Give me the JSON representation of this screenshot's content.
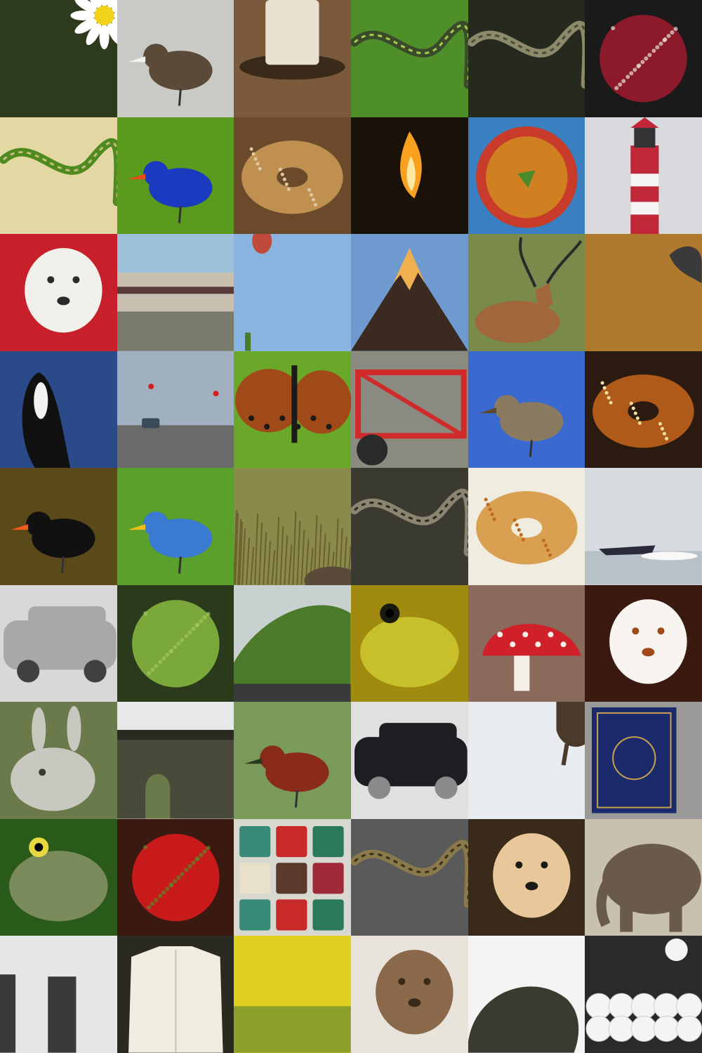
{
  "grid": {
    "columns": 6,
    "rows": 9,
    "tiles": [
      {
        "name": "daisy-flower",
        "subject": "flower",
        "bg": "#2e3a1c",
        "fg": "#ffffff",
        "accent": "#f2d31a"
      },
      {
        "name": "sandpiper-bird",
        "subject": "bird",
        "bg": "#c9c9c6",
        "fg": "#5b4a37",
        "accent": "#f1f1ef"
      },
      {
        "name": "coffee-cup",
        "subject": "cup",
        "bg": "#7a5a3a",
        "fg": "#e8e0d0",
        "accent": "#3a2a1a"
      },
      {
        "name": "green-snake-leaf",
        "subject": "snake",
        "bg": "#4f8f2a",
        "fg": "#3a4a2a",
        "accent": "#9fcf4a"
      },
      {
        "name": "viper-snake",
        "subject": "snake",
        "bg": "#262a1e",
        "fg": "#8c8a6a",
        "accent": "#4a4a3a"
      },
      {
        "name": "pomegranate",
        "subject": "fruit",
        "bg": "#1a1a1a",
        "fg": "#8c1a2a",
        "accent": "#e7e0d6"
      },
      {
        "name": "green-vine-snake",
        "subject": "snake",
        "bg": "#e3d7a4",
        "fg": "#4f8a1e",
        "accent": "#c8bb80"
      },
      {
        "name": "blue-bird",
        "subject": "bird",
        "bg": "#5a9a1c",
        "fg": "#1a3ac0",
        "accent": "#e84a1a"
      },
      {
        "name": "bagel-bread",
        "subject": "bread",
        "bg": "#6a4a2a",
        "fg": "#c09050",
        "accent": "#e0c8a0"
      },
      {
        "name": "flame-torch",
        "subject": "fire",
        "bg": "#1a1208",
        "fg": "#f8a020",
        "accent": "#ffe8a0"
      },
      {
        "name": "soup-bowl",
        "subject": "food",
        "bg": "#3a80c0",
        "fg": "#d08020",
        "accent": "#c83a2a"
      },
      {
        "name": "lighthouse",
        "subject": "tower",
        "bg": "#d8dade",
        "fg": "#c0283a",
        "accent": "#f4f4f4"
      },
      {
        "name": "shih-tzu-dog",
        "subject": "dog",
        "bg": "#c8202a",
        "fg": "#f2f0ea",
        "accent": "#2a2a2a"
      },
      {
        "name": "passenger-train",
        "subject": "train",
        "bg": "#9ec0d8",
        "fg": "#c8c0b0",
        "accent": "#5a3a3a"
      },
      {
        "name": "hot-air-balloon-sky",
        "subject": "sky",
        "bg": "#8ab4e0",
        "fg": "#3a3a6a",
        "accent": "#c04a3a"
      },
      {
        "name": "erupting-volcano",
        "subject": "mountain",
        "bg": "#6e9ad0",
        "fg": "#3a2a20",
        "accent": "#f0b050"
      },
      {
        "name": "impala-antelope",
        "subject": "antelope",
        "bg": "#7a8a4a",
        "fg": "#a0683a",
        "accent": "#2a2a2a"
      },
      {
        "name": "golden-surface",
        "subject": "object",
        "bg": "#b07a2e",
        "fg": "#3a3a3a",
        "accent": "#d0a050"
      },
      {
        "name": "orca-whale",
        "subject": "whale",
        "bg": "#2a4a8a",
        "fg": "#111111",
        "accent": "#f2f2f2"
      },
      {
        "name": "traffic-intersection",
        "subject": "street",
        "bg": "#a0b0c0",
        "fg": "#6a6a6a",
        "accent": "#d02020"
      },
      {
        "name": "brown-butterfly",
        "subject": "butterfly",
        "bg": "#6aa82a",
        "fg": "#a04a1a",
        "accent": "#1a1a1a"
      },
      {
        "name": "red-machinery",
        "subject": "machine",
        "bg": "#8a8a80",
        "fg": "#d02a2a",
        "accent": "#2a2a2a"
      },
      {
        "name": "perched-sparrow",
        "subject": "bird",
        "bg": "#3a6ad0",
        "fg": "#8a7a60",
        "accent": "#5a4a30"
      },
      {
        "name": "glazed-pretzel",
        "subject": "bread",
        "bg": "#2a1a10",
        "fg": "#b05a1a",
        "accent": "#f0e0a0"
      },
      {
        "name": "oystercatcher-bird",
        "subject": "bird",
        "bg": "#5a4a1a",
        "fg": "#111111",
        "accent": "#f05a1a"
      },
      {
        "name": "rainbow-lorikeet",
        "subject": "bird",
        "bg": "#5aa02a",
        "fg": "#3a7ad0",
        "accent": "#f0c020"
      },
      {
        "name": "dry-grass-field",
        "subject": "grass",
        "bg": "#8a8a4a",
        "fg": "#6a6030",
        "accent": "#a09a5a"
      },
      {
        "name": "rattlesnake-coil",
        "subject": "snake",
        "bg": "#3a3a30",
        "fg": "#8a8470",
        "accent": "#2a2a20"
      },
      {
        "name": "crumpets-bread",
        "subject": "bread",
        "bg": "#f0ece0",
        "fg": "#d8a050",
        "accent": "#c06a1a"
      },
      {
        "name": "speedboat-water",
        "subject": "boat",
        "bg": "#d8dce0",
        "fg": "#2a2a3a",
        "accent": "#f8f8f8"
      },
      {
        "name": "silver-minivan",
        "subject": "car",
        "bg": "#d8d8d8",
        "fg": "#a8a8a8",
        "accent": "#404040"
      },
      {
        "name": "green-papayas",
        "subject": "fruit",
        "bg": "#2a3a1a",
        "fg": "#7aa83a",
        "accent": "#a0c860"
      },
      {
        "name": "green-hill",
        "subject": "hill",
        "bg": "#c8d0d0",
        "fg": "#4a7a2a",
        "accent": "#3a3a3a"
      },
      {
        "name": "yellow-frog",
        "subject": "frog",
        "bg": "#a08a10",
        "fg": "#c8c02a",
        "accent": "#1a1a10"
      },
      {
        "name": "red-mushroom",
        "subject": "mushroom",
        "bg": "#8a6a5a",
        "fg": "#d0202a",
        "accent": "#f4f0e8"
      },
      {
        "name": "papillon-dog",
        "subject": "dog",
        "bg": "#3a1a10",
        "fg": "#f8f4f0",
        "accent": "#a04a1a"
      },
      {
        "name": "grey-rabbit",
        "subject": "rabbit",
        "bg": "#6a7a4a",
        "fg": "#c8c8c0",
        "accent": "#3a3a30"
      },
      {
        "name": "stone-viaduct",
        "subject": "bridge",
        "bg": "#e8e8e8",
        "fg": "#4a4a3a",
        "accent": "#2a2a20"
      },
      {
        "name": "red-grouse-bird",
        "subject": "bird",
        "bg": "#7a9a5a",
        "fg": "#8a2a1a",
        "accent": "#2a3a1a"
      },
      {
        "name": "black-sports-car",
        "subject": "car",
        "bg": "#e0e0e0",
        "fg": "#1e1e22",
        "accent": "#8a8a8a"
      },
      {
        "name": "snow-dog",
        "subject": "snow",
        "bg": "#e8ecf0",
        "fg": "#4a3a2a",
        "accent": "#ffffff"
      },
      {
        "name": "blue-gold-book",
        "subject": "book",
        "bg": "#9a9a98",
        "fg": "#1a2a6a",
        "accent": "#c8a050"
      },
      {
        "name": "tree-frog",
        "subject": "frog",
        "bg": "#2a5a1a",
        "fg": "#7a8a5a",
        "accent": "#e8d840"
      },
      {
        "name": "strawberry",
        "subject": "fruit",
        "bg": "#3a1a10",
        "fg": "#c81a1a",
        "accent": "#5a8a2a"
      },
      {
        "name": "watercolor-palette",
        "subject": "palette",
        "bg": "#d8d8d0",
        "fg": "#3a8a7a",
        "accent": "#c82a2a"
      },
      {
        "name": "garter-snake-ground",
        "subject": "snake",
        "bg": "#5a5a5a",
        "fg": "#8a7a4a",
        "accent": "#3a3020"
      },
      {
        "name": "pomeranian-puppy",
        "subject": "dog",
        "bg": "#3a2a1a",
        "fg": "#e8c89a",
        "accent": "#1a1a1a"
      },
      {
        "name": "elephant",
        "subject": "elephant",
        "bg": "#c8c0b0",
        "fg": "#6a5a4a",
        "accent": "#a89a8a"
      },
      {
        "name": "standing-stones",
        "subject": "stones",
        "bg": "#e6e6e6",
        "fg": "#3a3a3a",
        "accent": "#5a5a5a"
      },
      {
        "name": "white-shirt",
        "subject": "shirt",
        "bg": "#2a2a20",
        "fg": "#f0ece0",
        "accent": "#c8c4b8"
      },
      {
        "name": "canola-field",
        "subject": "field",
        "bg": "#e0d020",
        "fg": "#8aa02a",
        "accent": "#c8b820"
      },
      {
        "name": "puppy-on-bed",
        "subject": "dog",
        "bg": "#e8e4dc",
        "fg": "#8a6a4a",
        "accent": "#3a2a1a"
      },
      {
        "name": "hedgehog",
        "subject": "hedgehog",
        "bg": "#f4f4f4",
        "fg": "#3a3a30",
        "accent": "#6a6a5a"
      },
      {
        "name": "golf-balls",
        "subject": "balls",
        "bg": "#2a2a2a",
        "fg": "#f4f4f4",
        "accent": "#4a7a2a"
      }
    ]
  }
}
